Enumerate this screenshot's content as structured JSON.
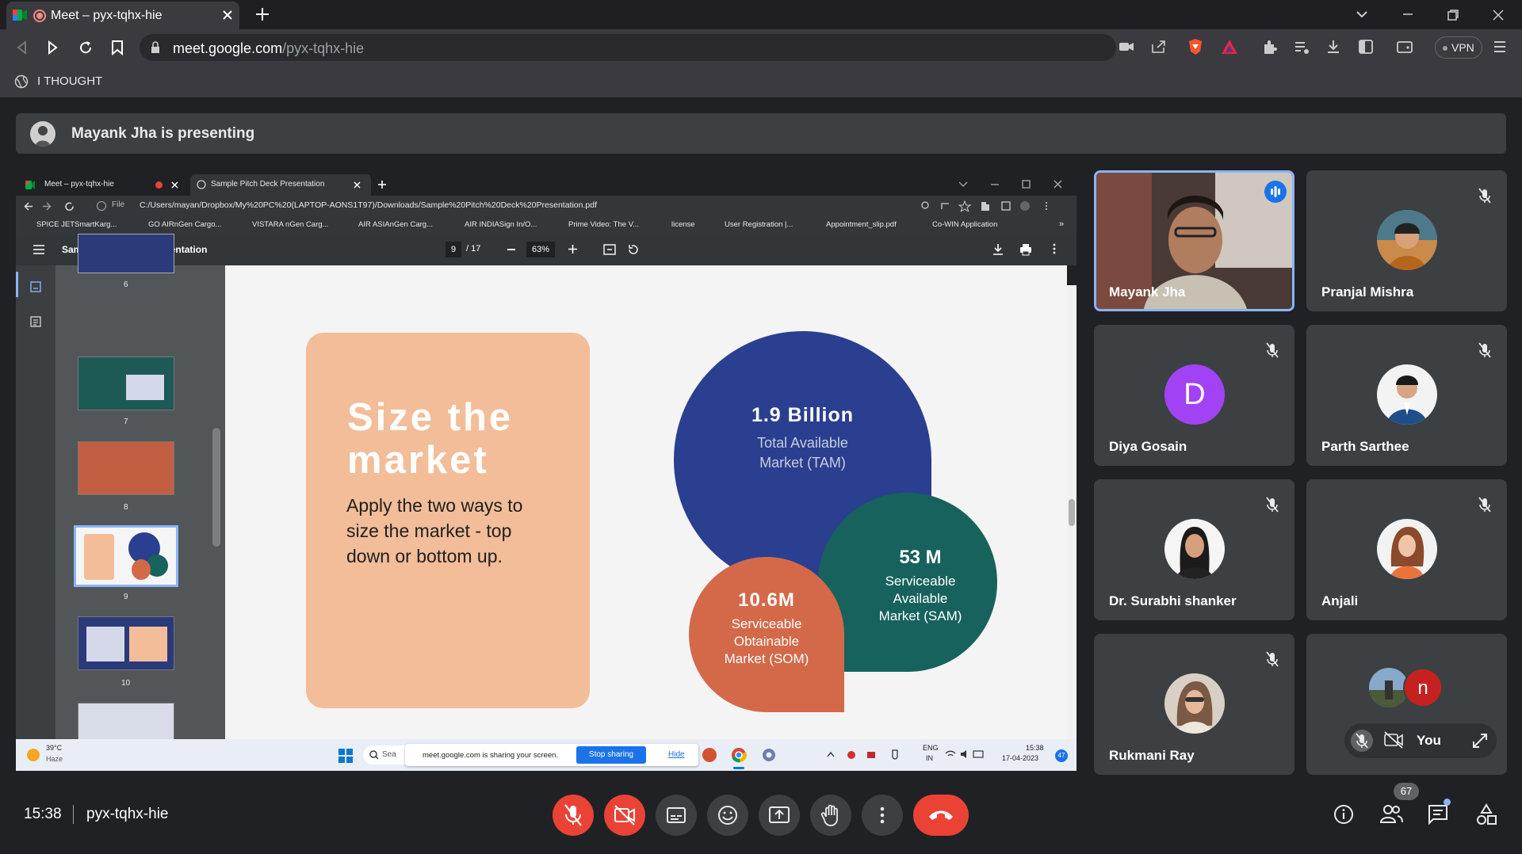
{
  "browser": {
    "tab_title": "Meet – pyx-tqhx-hie",
    "url_host": "meet.google.com",
    "url_path": "/pyx-tqhx-hie",
    "bookmark_label": "I THOUGHT",
    "vpn_label": "VPN"
  },
  "banner": {
    "text": "Mayank Jha is presenting"
  },
  "shared": {
    "tab1": "Meet – pyx-tqhx-hie",
    "tab2": "Sample Pitch Deck Presentation",
    "file_label": "File",
    "path": "C:/Users/mayan/Dropbox/My%20PC%20(LAPTOP-AONS1T97)/Downloads/Sample%20Pitch%20Deck%20Presentation.pdf",
    "bookmarks": [
      "SPICE JETSmartKarg...",
      "GO AIRnGen Cargo...",
      "VISTARA nGen Carg...",
      "AIR ASIAnGen Carg...",
      "AIR INDIASign In/O...",
      "Prime Video: The V...",
      "license",
      "User Registration |...",
      "Appointment_slip.pdf",
      "Co-WIN Application",
      "»"
    ],
    "pdf_title": "Sample Pitch Deck Presentation",
    "page_current": "9",
    "page_total": "/ 17",
    "zoom": "63%",
    "thumbs": [
      "6",
      "7",
      "8",
      "9",
      "10"
    ],
    "slide": {
      "title_line1": "Size the",
      "title_line2": "market",
      "body_line1": "Apply the two ways to",
      "body_line2": "size the market -  top",
      "body_line3": "down or bottom up.",
      "tam_value": "1.9 Billion",
      "tam_line1": "Total Available",
      "tam_line2": "Market (TAM)",
      "sam_value": "53 M",
      "sam_line1": "Serviceable",
      "sam_line2": "Available",
      "sam_line3": "Market (SAM)",
      "som_value": "10.6M",
      "som_line1": "Serviceable",
      "som_line2": "Obtainable",
      "som_line3": "Market (SOM)"
    },
    "taskbar": {
      "weather_temp": "39°C",
      "weather_desc": "Haze",
      "search": "Sea",
      "sharing_msg": "meet.google.com is sharing your screen.",
      "stop_sharing": "Stop sharing",
      "hide": "Hide",
      "lang1": "ENG",
      "lang2": "IN",
      "time": "15:38",
      "date": "17-04-2023",
      "badge": "47"
    }
  },
  "participants": [
    {
      "name": "Mayank Jha"
    },
    {
      "name": "Pranjal Mishra"
    },
    {
      "name": "Diya Gosain",
      "initial": "D"
    },
    {
      "name": "Parth Sarthee"
    },
    {
      "name": "Dr. Surabhi shanker"
    },
    {
      "name": "Anjali"
    },
    {
      "name": "Rukmani Ray"
    }
  ],
  "self_tile": {
    "label": "You",
    "initial": "n"
  },
  "footer": {
    "time": "15:38",
    "meeting_code": "pyx-tqhx-hie",
    "participant_count": "67"
  },
  "colors": {
    "meet_bg": "#202124",
    "tile_bg": "#3c4043",
    "end_call": "#ea4335",
    "active_speaker": "#8ab4f8",
    "tam": "#2a3f8f",
    "sam": "#17625c",
    "som": "#d4694a",
    "slide_card": "#f2bd98"
  }
}
